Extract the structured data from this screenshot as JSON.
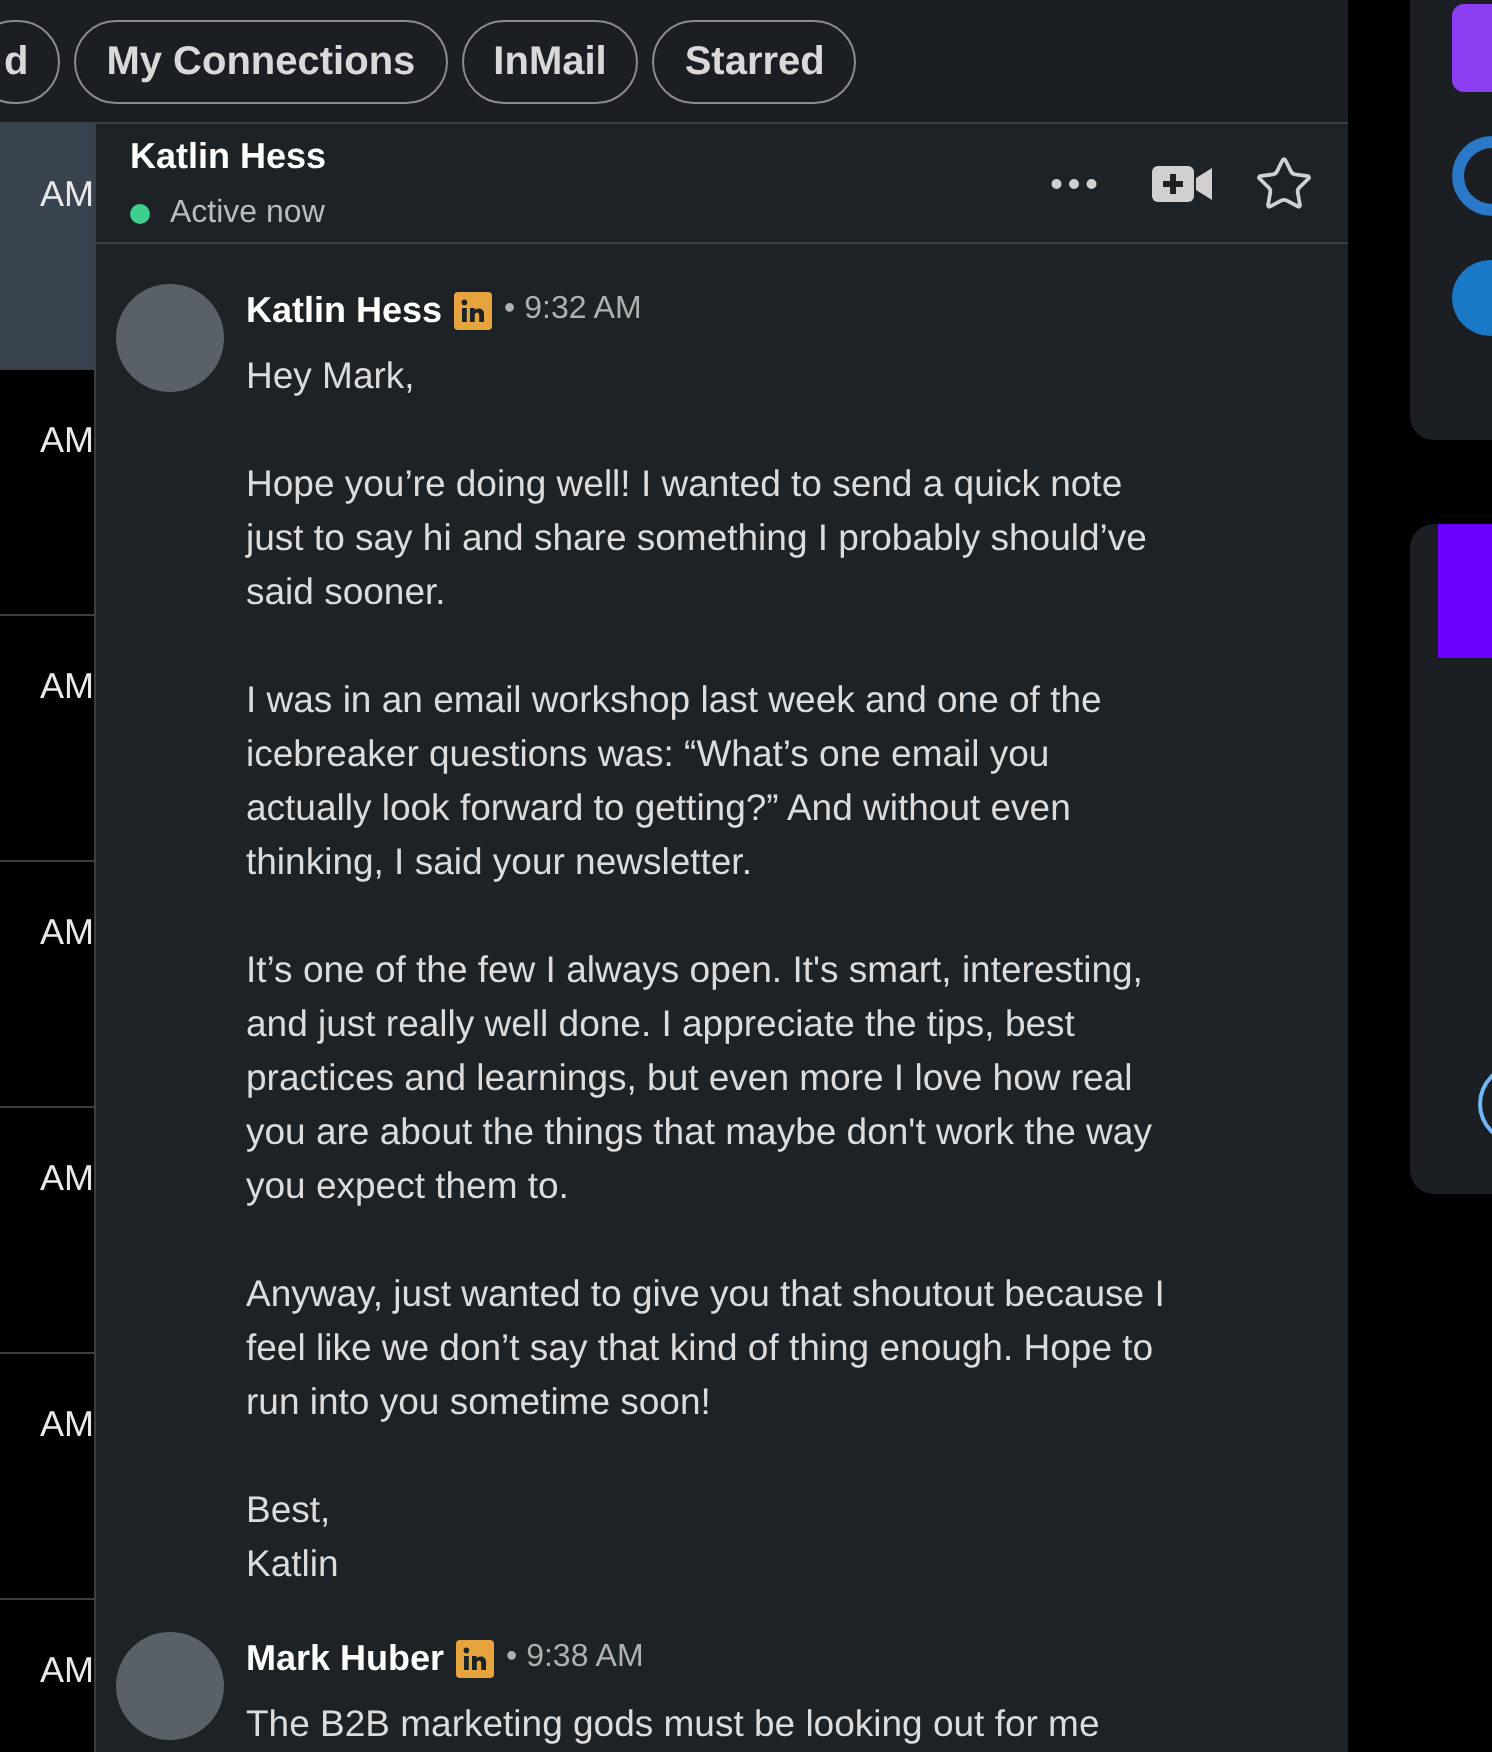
{
  "filters": [
    {
      "label": "d",
      "selected": false
    },
    {
      "label": "My Connections",
      "selected": false
    },
    {
      "label": "InMail",
      "selected": false
    },
    {
      "label": "Starred",
      "selected": false
    }
  ],
  "conversations": [
    {
      "time": "AM",
      "selected": true
    },
    {
      "time": "AM",
      "selected": false
    },
    {
      "time": "AM",
      "selected": false
    },
    {
      "time": "AM",
      "selected": false
    },
    {
      "time": "AM",
      "selected": false
    },
    {
      "time": "AM",
      "selected": false
    },
    {
      "time": "AM",
      "selected": false
    }
  ],
  "chat": {
    "name": "Katlin Hess",
    "status": "Active now",
    "online": true,
    "starred": false
  },
  "messages": [
    {
      "author": "Katlin Hess",
      "time": "• 9:32 AM",
      "paragraphs": [
        "Hey Mark,",
        "Hope you’re doing well! I wanted to send a quick note just to say hi and share something I probably should’ve said sooner.",
        "I was in an email workshop last week and one of the icebreaker questions was: “What’s one email you actually look forward to getting?” And without even thinking, I said your newsletter.",
        "It’s one of the few I always open. It's smart, interesting, and just really well done. I appreciate the tips, best practices and learnings, but even more I love how real you are about the things that maybe don't work the way you expect them to.",
        "Anyway, just wanted to give you that shoutout because I feel like we don’t say that kind of thing enough. Hope to run into you sometime soon!",
        "Best,\nKatlin"
      ]
    },
    {
      "author": "Mark Huber",
      "time": "• 9:38 AM",
      "paragraphs": [
        "The B2B marketing gods must be looking out for me"
      ]
    }
  ]
}
